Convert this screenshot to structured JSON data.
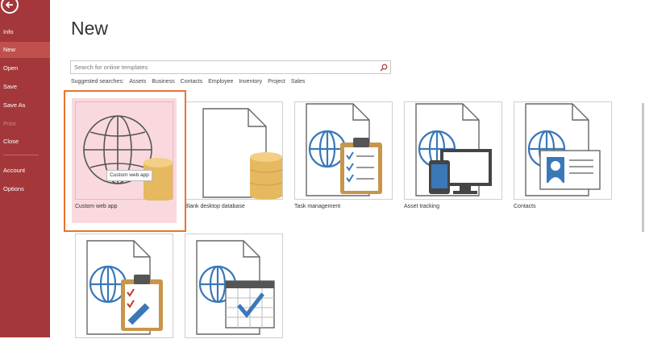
{
  "sidebar": {
    "items": [
      {
        "label": "Info"
      },
      {
        "label": "New"
      },
      {
        "label": "Open"
      },
      {
        "label": "Save"
      },
      {
        "label": "Save As"
      },
      {
        "label": "Print"
      },
      {
        "label": "Close"
      },
      {
        "label": "Account"
      },
      {
        "label": "Options"
      }
    ],
    "active": "New",
    "color": "#a4373a"
  },
  "main": {
    "title": "New",
    "search_placeholder": "Search for online templates",
    "suggested_label": "Suggested searches:",
    "suggested": [
      "Assets",
      "Business",
      "Contacts",
      "Employee",
      "Inventory",
      "Project",
      "Sales"
    ]
  },
  "templates": [
    {
      "label": "Custom web app",
      "icon": "globe-database-icon"
    },
    {
      "label": "Blank desktop database",
      "icon": "blank-document-database-icon"
    },
    {
      "label": "Task management",
      "icon": "document-globe-checklist-icon"
    },
    {
      "label": "Asset tracking",
      "icon": "document-globe-devices-icon"
    },
    {
      "label": "Contacts",
      "icon": "document-globe-contact-card-icon"
    },
    {
      "label": "",
      "icon": "document-globe-clipboard-pencil-icon"
    },
    {
      "label": "",
      "icon": "document-globe-calendar-icon"
    }
  ],
  "tooltip": "Custom web app",
  "accent_color": "#e7742d"
}
